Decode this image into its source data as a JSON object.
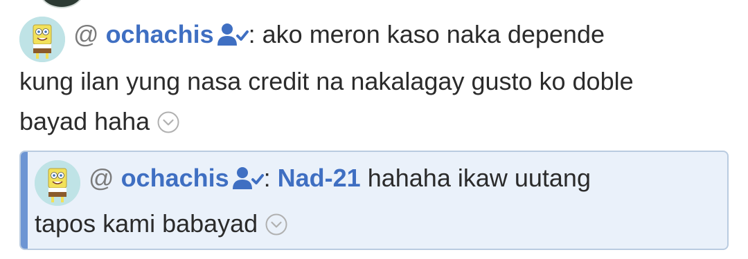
{
  "comment": {
    "at": "@",
    "username": "ochachis",
    "colon": ":",
    "text_line1": " ako meron kaso naka depende",
    "text_line2": "kung ilan yung nasa credit na nakalagay gusto ko doble",
    "text_line3": "bayad haha"
  },
  "reply": {
    "at": "@",
    "username": "ochachis",
    "colon": ":",
    "mention": "Nad-21",
    "text_line1": " hahaha ikaw uutang",
    "text_line2": "tapos kami babayad"
  },
  "colors": {
    "username": "#3f6fc2",
    "reply_background": "#eaf1fa",
    "reply_border": "#b9cbe0",
    "reply_bar": "#6d95d3"
  },
  "icons": {
    "avatar": "spongebob-avatar",
    "verified": "user-check-icon",
    "expand": "chevron-down-circle-icon"
  }
}
